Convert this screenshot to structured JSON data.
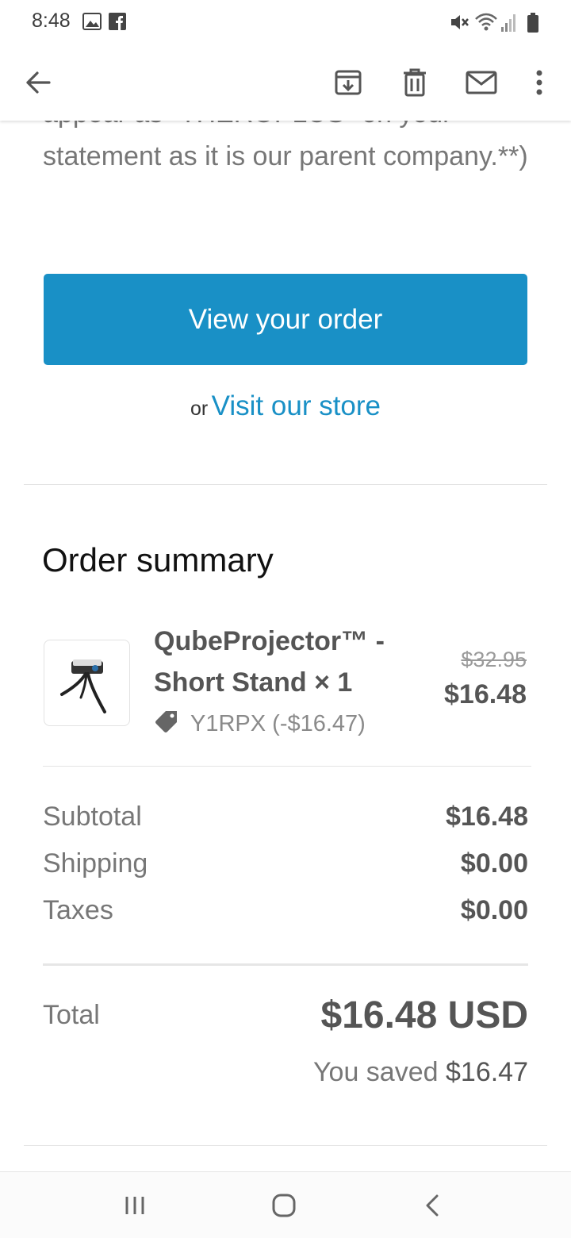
{
  "status_bar": {
    "time": "8:48",
    "left_icons": [
      "gallery-icon",
      "facebook-icon"
    ],
    "right_icons": [
      "mute-icon",
      "wifi-icon",
      "signal-icon",
      "battery-icon"
    ]
  },
  "app_bar": {
    "actions": [
      "back-arrow-icon",
      "archive-icon",
      "delete-icon",
      "mark-unread-icon",
      "more-options-icon"
    ]
  },
  "email": {
    "intro_text": "appear as \"THEROPLUS\" on your statement as it is our parent company.**)",
    "view_order_label": "View your order",
    "or_text": "or",
    "visit_store_label": "Visit our store"
  },
  "order_summary": {
    "title": "Order summary",
    "item": {
      "name": "QubeProjector™ - Short Stand × 1",
      "discount_code": "Y1RPX (-$16.47)",
      "original_price": "$32.95",
      "price": "$16.48"
    },
    "rows": [
      {
        "label": "Subtotal",
        "value": "$16.48"
      },
      {
        "label": "Shipping",
        "value": "$0.00"
      },
      {
        "label": "Taxes",
        "value": "$0.00"
      }
    ],
    "total_label": "Total",
    "total_value": "$16.48 USD",
    "saved_label": "You saved",
    "saved_amount": "$16.47"
  },
  "colors": {
    "accent": "#1990c6",
    "muted_text": "#777777",
    "strong_text": "#555555"
  },
  "nav_bar": {
    "buttons": [
      "recent-apps-icon",
      "home-icon",
      "back-icon"
    ]
  }
}
